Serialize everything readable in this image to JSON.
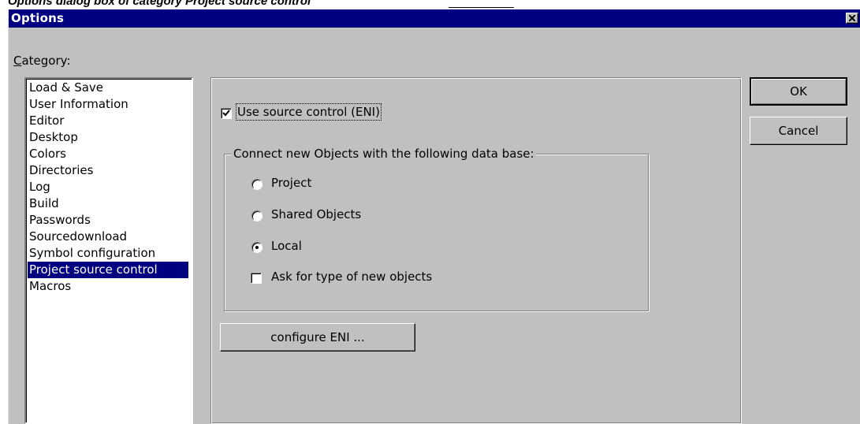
{
  "caption": "Options dialog box of category Project source control",
  "window": {
    "title": "Options",
    "close_symbol": "×"
  },
  "category": {
    "label": "Category:",
    "items": [
      "Load & Save",
      "User Information",
      "Editor",
      "Desktop",
      "Colors",
      "Directories",
      "Log",
      "Build",
      "Passwords",
      "Sourcedownload",
      "Symbol configuration",
      "Project source control",
      "Macros"
    ],
    "selected_index": 11
  },
  "source_control": {
    "use_label": "Use source control (ENI)",
    "use_checked": true,
    "group_label": "Connect new Objects with the following data base:",
    "radio_options": [
      "Project",
      "Shared Objects",
      "Local"
    ],
    "radio_selected": 2,
    "ask_label": "Ask for type of new objects",
    "ask_checked": false,
    "configure_label": "configure ENI ..."
  },
  "buttons": {
    "ok": "OK",
    "cancel": "Cancel"
  }
}
